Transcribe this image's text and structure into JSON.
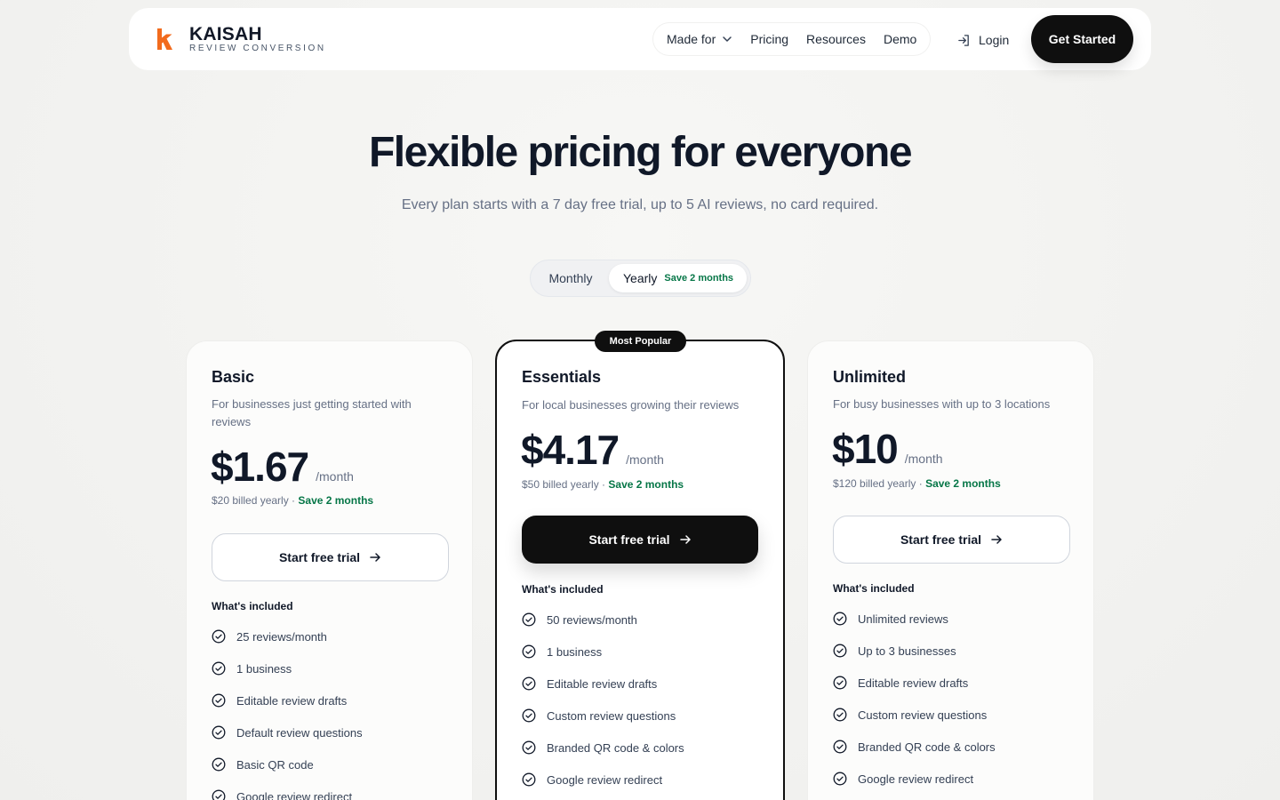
{
  "nav": {
    "brand_name": "KAISAH",
    "brand_sub": "REVIEW CONVERSION",
    "links": [
      {
        "label": "Made for"
      },
      {
        "label": "Pricing"
      },
      {
        "label": "Resources"
      },
      {
        "label": "Demo"
      }
    ],
    "login_label": "Login",
    "cta_label": "Get Started"
  },
  "hero": {
    "title": "Flexible pricing for everyone",
    "subtitle": "Every plan starts with a 7 day free trial, up to 5 AI reviews, no card required."
  },
  "billing_toggle": {
    "monthly_label": "Monthly",
    "yearly_label": "Yearly",
    "yearly_save": "Save 2 months",
    "selected": "Yearly"
  },
  "plans": [
    {
      "name": "Basic",
      "description": "For businesses just getting started with reviews",
      "price": "$1.67",
      "per": "/month",
      "billed": "$20 billed yearly · ",
      "save": "Save 2 months",
      "button": "Start free trial",
      "included_label": "What's included",
      "features": [
        "25 reviews/month",
        "1 business",
        "Editable review drafts",
        "Default review questions",
        "Basic QR code",
        "Google review redirect"
      ]
    },
    {
      "name": "Essentials",
      "badge": "Most Popular",
      "description": "For local businesses growing their reviews",
      "price": "$4.17",
      "per": "/month",
      "billed": "$50 billed yearly · ",
      "save": "Save 2 months",
      "button": "Start free trial",
      "included_label": "What's included",
      "features": [
        "50 reviews/month",
        "1 business",
        "Editable review drafts",
        "Custom review questions",
        "Branded QR code & colors",
        "Google review redirect"
      ]
    },
    {
      "name": "Unlimited",
      "description": "For busy businesses with up to 3 locations",
      "price": "$10",
      "per": "/month",
      "billed": "$120 billed yearly · ",
      "save": "Save 2 months",
      "button": "Start free trial",
      "included_label": "What's included",
      "features": [
        "Unlimited reviews",
        "Up to 3 businesses",
        "Editable review drafts",
        "Custom review questions",
        "Branded QR code & colors",
        "Google review redirect"
      ]
    }
  ],
  "colors": {
    "accent_logo": "#f26b1d",
    "save_green": "#067647",
    "cta_dark": "#0f0f0f"
  }
}
